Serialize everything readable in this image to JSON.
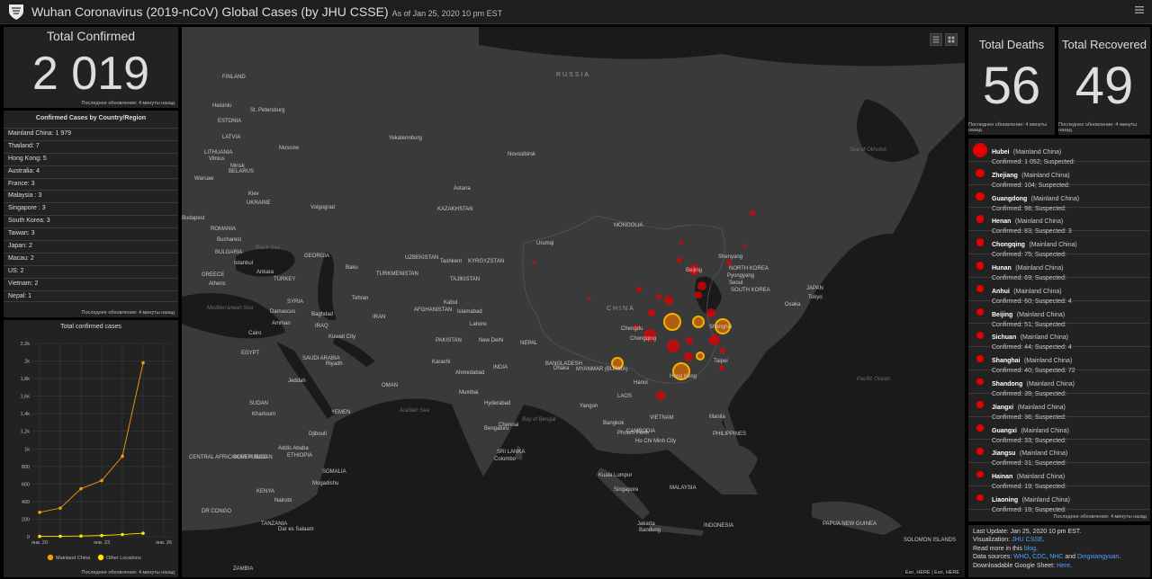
{
  "header": {
    "title": "Wuhan Coronavirus (2019-nCoV) Global Cases (by JHU CSSE)",
    "as_of": "As of Jan 25, 2020 10 pm EST"
  },
  "total_confirmed": {
    "label": "Total Confirmed",
    "value": "2 019",
    "footnote": "Последнее обновление: 4 минуты назад"
  },
  "countries": {
    "title": "Confirmed Cases by Country/Region",
    "items": [
      "Mainland China: 1 979",
      "Thailand: 7",
      "Hong Kong: 5",
      "Australia: 4",
      "France: 3",
      "Malaysia : 3",
      "Singapore : 3",
      "South Korea: 3",
      "Taiwan: 3",
      "Japan: 2",
      "Macau: 2",
      "US: 2",
      "Vietnam: 2",
      "Nepal: 1"
    ],
    "footnote": "Последнее обновление: 4 минуты назад"
  },
  "chart_data": {
    "type": "line",
    "title": "Total confirmed cases",
    "x": [
      "янв. 20",
      "янв. 21",
      "янв. 22",
      "янв. 23",
      "янв. 24",
      "янв. 25",
      "янв. 26"
    ],
    "x_tick_labels": [
      "янв. 20",
      "янв. 23",
      "янв. 26"
    ],
    "yticks": [
      "0",
      "200",
      "400",
      "600",
      "800",
      "1k",
      "1,2k",
      "1,4k",
      "1,6k",
      "1,8k",
      "2k",
      "2,2k"
    ],
    "ylim": [
      0,
      2200
    ],
    "series": [
      {
        "name": "Mainland China",
        "color": "#f5a000",
        "values": [
          278,
          326,
          547,
          639,
          916,
          1979
        ]
      },
      {
        "name": "Other Locations",
        "color": "#ffe600",
        "values": [
          4,
          6,
          8,
          14,
          25,
          40
        ]
      }
    ],
    "grid": true,
    "legend": "bottom",
    "footnote": "Последнее обновление: 4 минуты назад"
  },
  "map": {
    "labels": [
      {
        "t": "RUSSIA",
        "k": "big"
      },
      {
        "t": "CHINA",
        "k": "big"
      },
      {
        "t": "FINLAND"
      },
      {
        "t": "Helsinki"
      },
      {
        "t": "St. Petersburg"
      },
      {
        "t": "ESTONIA"
      },
      {
        "t": "LATVIA"
      },
      {
        "t": "LITHUANIA"
      },
      {
        "t": "Vilnius"
      },
      {
        "t": "Minsk"
      },
      {
        "t": "BELARUS"
      },
      {
        "t": "Moscow"
      },
      {
        "t": "Warsaw"
      },
      {
        "t": "Kiev"
      },
      {
        "t": "UKRAINE"
      },
      {
        "t": "Yekaterinburg"
      },
      {
        "t": "Novosibirsk"
      },
      {
        "t": "Astana"
      },
      {
        "t": "KAZAKHSTAN"
      },
      {
        "t": "Volgograd"
      },
      {
        "t": "Budapest"
      },
      {
        "t": "ROMANIA"
      },
      {
        "t": "Bucharest"
      },
      {
        "t": "BULGARIA"
      },
      {
        "t": "Istanbul"
      },
      {
        "t": "Ankara"
      },
      {
        "t": "Athens"
      },
      {
        "t": "GREECE"
      },
      {
        "t": "TURKEY"
      },
      {
        "t": "GEORGIA"
      },
      {
        "t": "Baku"
      },
      {
        "t": "TURKMENISTAN"
      },
      {
        "t": "UZBEKISTAN"
      },
      {
        "t": "Tashkent"
      },
      {
        "t": "KYRGYZSTAN"
      },
      {
        "t": "TAJIKISTAN"
      },
      {
        "t": "Tehran"
      },
      {
        "t": "IRAN"
      },
      {
        "t": "SYRIA"
      },
      {
        "t": "Damascus"
      },
      {
        "t": "Amman"
      },
      {
        "t": "Baghdad"
      },
      {
        "t": "IRAQ"
      },
      {
        "t": "Cairo"
      },
      {
        "t": "EGYPT"
      },
      {
        "t": "Kuwait City"
      },
      {
        "t": "SAUDI ARABIA"
      },
      {
        "t": "Riyadh"
      },
      {
        "t": "Jeddah"
      },
      {
        "t": "OMAN"
      },
      {
        "t": "YEMEN"
      },
      {
        "t": "SUDAN"
      },
      {
        "t": "Khartoum"
      },
      {
        "t": "Djibouti"
      },
      {
        "t": "Addis Ababa"
      },
      {
        "t": "ETHIOPIA"
      },
      {
        "t": "SOUTH SUDAN"
      },
      {
        "t": "SOMALIA"
      },
      {
        "t": "Mogadishu"
      },
      {
        "t": "KENYA"
      },
      {
        "t": "Nairobi"
      },
      {
        "t": "TANZANIA"
      },
      {
        "t": "Dar es Salaam"
      },
      {
        "t": "ZAMBIA"
      },
      {
        "t": "CENTRAL AFRICAN REPUBLIC"
      },
      {
        "t": "DR CONGO"
      },
      {
        "t": "AFGHANISTAN"
      },
      {
        "t": "Kabul"
      },
      {
        "t": "Islamabad"
      },
      {
        "t": "Lahore"
      },
      {
        "t": "PAKISTAN"
      },
      {
        "t": "Karachi"
      },
      {
        "t": "New Delhi"
      },
      {
        "t": "NEPAL"
      },
      {
        "t": "INDIA"
      },
      {
        "t": "Ahmedabad"
      },
      {
        "t": "Mumbai"
      },
      {
        "t": "Hyderabad"
      },
      {
        "t": "Bengaluru"
      },
      {
        "t": "Chennai"
      },
      {
        "t": "SRI LANKA"
      },
      {
        "t": "Colombo"
      },
      {
        "t": "Dhaka"
      },
      {
        "t": "BANGLADESH"
      },
      {
        "t": "MYANMAR (BURMA)"
      },
      {
        "t": "Yangon"
      },
      {
        "t": "LAOS"
      },
      {
        "t": "Bangkok"
      },
      {
        "t": "CAMBODIA"
      },
      {
        "t": "Phnom Penh"
      },
      {
        "t": "Ho Chi Minh City"
      },
      {
        "t": "VIETNAM"
      },
      {
        "t": "Hanoi"
      },
      {
        "t": "Kuala Lumpur"
      },
      {
        "t": "Singapore"
      },
      {
        "t": "MALAYSIA"
      },
      {
        "t": "Jakarta"
      },
      {
        "t": "Bandung"
      },
      {
        "t": "INDONESIA"
      },
      {
        "t": "Manila"
      },
      {
        "t": "PHILIPPINES"
      },
      {
        "t": "Taipei"
      },
      {
        "t": "Hong Kong"
      },
      {
        "t": "Chengdu"
      },
      {
        "t": "Chongqing"
      },
      {
        "t": "Shanghai"
      },
      {
        "t": "Beijing"
      },
      {
        "t": "Shenyang"
      },
      {
        "t": "Pyongyang"
      },
      {
        "t": "NORTH KOREA"
      },
      {
        "t": "SOUTH KOREA"
      },
      {
        "t": "Seoul"
      },
      {
        "t": "Tokyo"
      },
      {
        "t": "Osaka"
      },
      {
        "t": "JAPAN"
      },
      {
        "t": "MONGOLIA"
      },
      {
        "t": "Urumqi"
      },
      {
        "t": "PAPUA NEW GUINEA"
      },
      {
        "t": "SOLOMON ISLANDS"
      },
      {
        "t": "Black Sea",
        "k": "water"
      },
      {
        "t": "Mediterranean Sea",
        "k": "water"
      },
      {
        "t": "Arabian Sea",
        "k": "water"
      },
      {
        "t": "Bay of Bengal",
        "k": "water"
      },
      {
        "t": "Pacific Ocean",
        "k": "water"
      },
      {
        "t": "Sea of Okhotsk",
        "k": "water"
      }
    ],
    "attribution": "Esri, HERE | Esri, HERE"
  },
  "deaths": {
    "label": "Total Deaths",
    "value": "56",
    "footnote": "Последнее обновление: 4 минуты назад"
  },
  "recovered": {
    "label": "Total Recovered",
    "value": "49",
    "footnote": "Последнее обновление: 4 минуты назад"
  },
  "provinces": {
    "items": [
      {
        "name": "Hubei",
        "region": "(Mainland China)",
        "stats": "Confirmed: 1 052; Suspected:",
        "confirmed": 1052
      },
      {
        "name": "Zhejiang",
        "region": "(Mainland China)",
        "stats": "Confirmed: 104; Suspected:",
        "confirmed": 104
      },
      {
        "name": "Guangdong",
        "region": "(Mainland China)",
        "stats": "Confirmed: 98; Suspected:",
        "confirmed": 98
      },
      {
        "name": "Henan",
        "region": "(Mainland China)",
        "stats": "Confirmed: 83; Suspected: 3",
        "confirmed": 83
      },
      {
        "name": "Chongqing",
        "region": "(Mainland China)",
        "stats": "Confirmed: 75; Suspected:",
        "confirmed": 75
      },
      {
        "name": "Hunan",
        "region": "(Mainland China)",
        "stats": "Confirmed: 69; Suspected:",
        "confirmed": 69
      },
      {
        "name": "Anhui",
        "region": "(Mainland China)",
        "stats": "Confirmed: 60; Suspected: 4",
        "confirmed": 60
      },
      {
        "name": "Beijing",
        "region": "(Mainland China)",
        "stats": "Confirmed: 51; Suspected:",
        "confirmed": 51
      },
      {
        "name": "Sichuan",
        "region": "(Mainland China)",
        "stats": "Confirmed: 44; Suspected: 4",
        "confirmed": 44
      },
      {
        "name": "Shanghai",
        "region": "(Mainland China)",
        "stats": "Confirmed: 40; Suspected: 72",
        "confirmed": 40
      },
      {
        "name": "Shandong",
        "region": "(Mainland China)",
        "stats": "Confirmed: 39; Suspected:",
        "confirmed": 39
      },
      {
        "name": "Jiangxi",
        "region": "(Mainland China)",
        "stats": "Confirmed: 36; Suspected:",
        "confirmed": 36
      },
      {
        "name": "Guangxi",
        "region": "(Mainland China)",
        "stats": "Confirmed: 33; Suspected:",
        "confirmed": 33
      },
      {
        "name": "Jiangsu",
        "region": "(Mainland China)",
        "stats": "Confirmed: 31; Suspected:",
        "confirmed": 31
      },
      {
        "name": "Hainan",
        "region": "(Mainland China)",
        "stats": "Confirmed: 19; Suspected:",
        "confirmed": 19
      },
      {
        "name": "Liaoning",
        "region": "(Mainland China)",
        "stats": "Confirmed: 19; Suspected:",
        "confirmed": 19
      }
    ],
    "footnote": "Последнее обновление: 4 минуты назад"
  },
  "info": {
    "last_update": "Last Update: Jan 25, 2020 10 pm EST.",
    "viz_prefix": "Visualization:",
    "viz_link": "JHU CSSE",
    "viz_suffix": ".",
    "readmore_prefix": "Read more in this",
    "readmore_link": "blog",
    "readmore_suffix": ".",
    "sources_prefix": "Data sources:",
    "src_who": "WHO",
    "src_cdc": "CDC",
    "src_nhc": "NHC",
    "src_and": "and",
    "src_ding": "Dingxiangyuan",
    "sources_suffix": ".",
    "sheet_prefix": "Downloadable Google Sheet:",
    "sheet_link": "Here",
    "sheet_suffix": "."
  },
  "colors": {
    "accent_red": "#e60000",
    "link": "#4da3ff",
    "panel": "#222222",
    "map_land": "#3a3a3a",
    "map_water": "#1a1a1a"
  }
}
